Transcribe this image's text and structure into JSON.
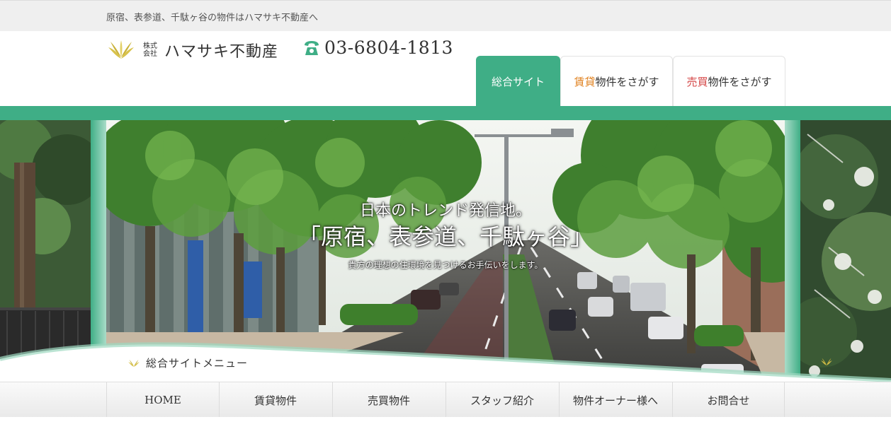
{
  "topbar": {
    "tagline": "原宿、表参道、千駄ヶ谷の物件はハマサキ不動産へ"
  },
  "logo": {
    "kabushiki": "株式\n会社",
    "kabushiki_line1": "株式",
    "kabushiki_line2": "会社",
    "name": "ハマサキ不動産",
    "icon": "leaf-logo-icon",
    "color": "#d8c24a"
  },
  "phone": {
    "icon": "phone-icon",
    "number": "03-6804-1813",
    "color": "#3fae86"
  },
  "tabs": [
    {
      "label": "総合サイト",
      "active": true
    },
    {
      "accent": "賃貸",
      "rest": "物件をさがす",
      "active": false
    },
    {
      "accent": "売買",
      "rest": "物件をさがす",
      "active": false
    }
  ],
  "hero": {
    "line1": "日本のトレンド発信地。",
    "line2": "「原宿、表参道、千駄ヶ谷」",
    "line3": "貴方の理想の住環境を見つけるお手伝いをします。"
  },
  "menu_title": "総合サイトメニュー",
  "nav": [
    "HOME",
    "賃貸物件",
    "売買物件",
    "スタッフ紹介",
    "物件オーナー様へ",
    "お問合せ"
  ],
  "colors": {
    "brand_green": "#3fae86",
    "rent_accent": "#e0811f",
    "sale_accent": "#d44545"
  }
}
